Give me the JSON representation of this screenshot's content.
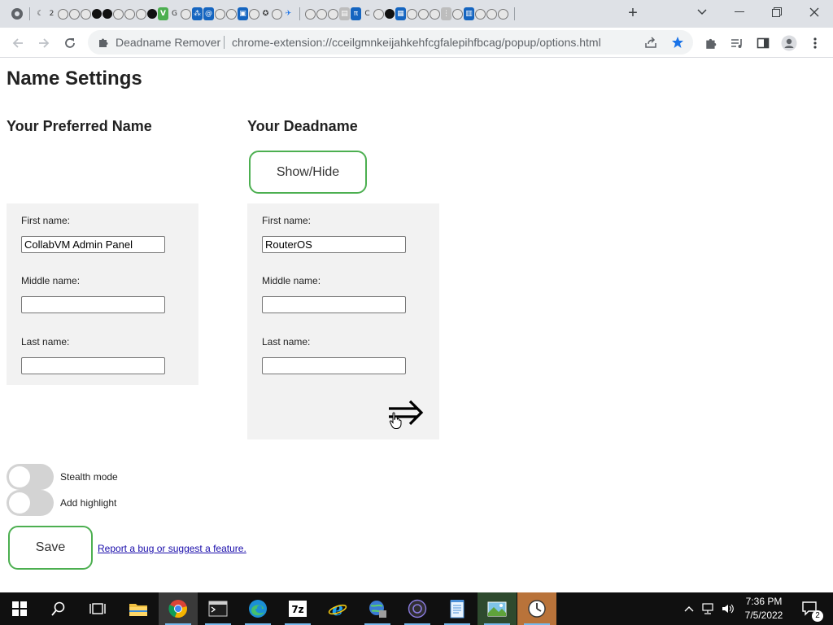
{
  "browser": {
    "tab_count_badge": "",
    "new_tab_label": "+",
    "window_controls": {
      "chevron": "⌄",
      "minimize": "—",
      "restore": "❐",
      "close": "✕"
    },
    "extension_name": "Deadname Remover",
    "url": "chrome-extension://cceilgmnkeijahkehfcgfalepihfbcag/popup/options.html",
    "icons": {
      "back": "back-arrow-icon",
      "forward": "forward-arrow-icon",
      "reload": "reload-icon",
      "extension": "puzzle-icon",
      "share": "share-icon",
      "bookmark": "star-icon",
      "extensions_menu": "puzzle-icon",
      "media": "media-control-icon",
      "side_panel": "side-panel-icon",
      "profile": "profile-icon",
      "menu": "kebab-menu-icon"
    },
    "bookmark_color": "#1a73e8"
  },
  "page": {
    "title": "Name Settings",
    "preferred": {
      "heading": "Your Preferred Name",
      "first_label": "First name:",
      "first_value": "CollabVM Admin Panel",
      "middle_label": "Middle name:",
      "middle_value": "",
      "last_label": "Last name:",
      "last_value": ""
    },
    "deadname": {
      "heading": "Your Deadname",
      "show_hide_label": "Show/Hide",
      "first_label": "First name:",
      "first_value": "RouterOS",
      "middle_label": "Middle name:",
      "middle_value": "",
      "last_label": "Last name:",
      "last_value": "",
      "add_icon": "double-right-arrow-icon"
    },
    "stealth_label": "Stealth mode",
    "stealth_on": false,
    "highlight_label": "Add highlight",
    "highlight_on": false,
    "save_label": "Save",
    "report_link": "Report a bug or suggest a feature.",
    "accent_color": "#4caf50"
  },
  "taskbar": {
    "time": "7:36 PM",
    "date": "7/5/2022",
    "notification_count": "2",
    "apps": [
      "start-icon",
      "search-icon",
      "task-view-icon",
      "file-explorer-icon",
      "chrome-icon",
      "terminal-icon",
      "edge-icon",
      "7zip-icon",
      "internet-explorer-icon",
      "network-app-icon",
      "obs-icon",
      "notepad-icon",
      "image-app-icon",
      "clock-app-icon"
    ]
  }
}
